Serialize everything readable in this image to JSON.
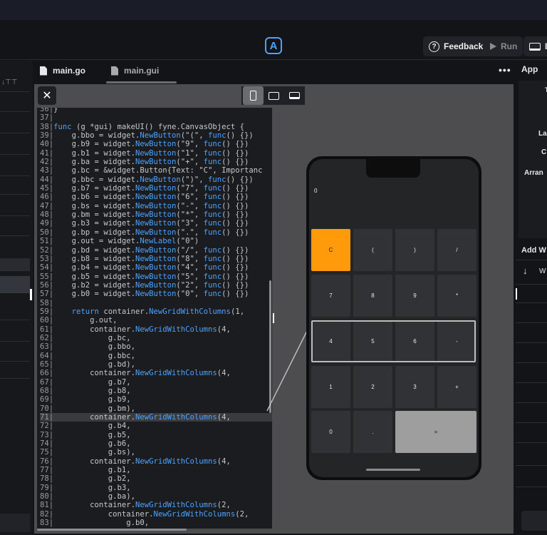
{
  "toolbar": {
    "feedback_label": "Feedback",
    "run_label": "Run",
    "install_label": "In"
  },
  "left_panel": {
    "header_glyphs": "↓⊤⊤"
  },
  "tabs": [
    {
      "label": "main.go"
    },
    {
      "label": "main.gui"
    }
  ],
  "more_label": "•••",
  "code": {
    "lines": [
      {
        "n": "36",
        "t": "}"
      },
      {
        "n": "37",
        "t": ""
      },
      {
        "n": "38",
        "t": "func (g *gui) makeUI() fyne.CanvasObject {"
      },
      {
        "n": "39",
        "t": "    g.bbo = widget.NewButton(\"(\", func() {})"
      },
      {
        "n": "40",
        "t": "    g.b9 = widget.NewButton(\"9\", func() {})"
      },
      {
        "n": "41",
        "t": "    g.b1 = widget.NewButton(\"1\", func() {})"
      },
      {
        "n": "42",
        "t": "    g.ba = widget.NewButton(\"+\", func() {})"
      },
      {
        "n": "43",
        "t": "    g.bc = &widget.Button{Text: \"C\", Importanc"
      },
      {
        "n": "44",
        "t": "    g.bbc = widget.NewButton(\")\", func() {})"
      },
      {
        "n": "45",
        "t": "    g.b7 = widget.NewButton(\"7\", func() {})"
      },
      {
        "n": "46",
        "t": "    g.b6 = widget.NewButton(\"6\", func() {})"
      },
      {
        "n": "47",
        "t": "    g.bs = widget.NewButton(\"-\", func() {})"
      },
      {
        "n": "48",
        "t": "    g.bm = widget.NewButton(\"*\", func() {})"
      },
      {
        "n": "49",
        "t": "    g.b3 = widget.NewButton(\"3\", func() {})"
      },
      {
        "n": "50",
        "t": "    g.bp = widget.NewButton(\".\", func() {})"
      },
      {
        "n": "51",
        "t": "    g.out = widget.NewLabel(\"0\")"
      },
      {
        "n": "52",
        "t": "    g.bd = widget.NewButton(\"/\", func() {})"
      },
      {
        "n": "53",
        "t": "    g.b8 = widget.NewButton(\"8\", func() {})"
      },
      {
        "n": "54",
        "t": "    g.b4 = widget.NewButton(\"4\", func() {})"
      },
      {
        "n": "55",
        "t": "    g.b5 = widget.NewButton(\"5\", func() {})"
      },
      {
        "n": "56",
        "t": "    g.b2 = widget.NewButton(\"2\", func() {})"
      },
      {
        "n": "57",
        "t": "    g.b0 = widget.NewButton(\"0\", func() {})"
      },
      {
        "n": "58",
        "t": ""
      },
      {
        "n": "59",
        "t": "    return container.NewGridWithColumns(1,"
      },
      {
        "n": "60",
        "t": "        g.out,"
      },
      {
        "n": "61",
        "t": "        container.NewGridWithColumns(4,"
      },
      {
        "n": "62",
        "t": "            g.bc,"
      },
      {
        "n": "63",
        "t": "            g.bbo,"
      },
      {
        "n": "64",
        "t": "            g.bbc,"
      },
      {
        "n": "65",
        "t": "            g.bd),"
      },
      {
        "n": "66",
        "t": "        container.NewGridWithColumns(4,"
      },
      {
        "n": "67",
        "t": "            g.b7,"
      },
      {
        "n": "68",
        "t": "            g.b8,"
      },
      {
        "n": "69",
        "t": "            g.b9,"
      },
      {
        "n": "70",
        "t": "            g.bm),"
      },
      {
        "n": "71",
        "t": "        container.NewGridWithColumns(4,"
      },
      {
        "n": "72",
        "t": "            g.b4,"
      },
      {
        "n": "73",
        "t": "            g.b5,"
      },
      {
        "n": "74",
        "t": "            g.b6,"
      },
      {
        "n": "75",
        "t": "            g.bs),"
      },
      {
        "n": "76",
        "t": "        container.NewGridWithColumns(4,"
      },
      {
        "n": "77",
        "t": "            g.b1,"
      },
      {
        "n": "78",
        "t": "            g.b2,"
      },
      {
        "n": "79",
        "t": "            g.b3,"
      },
      {
        "n": "80",
        "t": "            g.ba),"
      },
      {
        "n": "81",
        "t": "        container.NewGridWithColumns(2,"
      },
      {
        "n": "82",
        "t": "            container.NewGridWithColumns(2,"
      },
      {
        "n": "83",
        "t": "                g.b0,"
      }
    ],
    "highlighted_line": "71"
  },
  "preview": {
    "output": "0",
    "buttons": [
      {
        "label": "C",
        "style": "orange"
      },
      {
        "label": "(",
        "style": "normal"
      },
      {
        "label": ")",
        "style": "normal"
      },
      {
        "label": "/",
        "style": "normal"
      },
      {
        "label": "7",
        "style": "normal"
      },
      {
        "label": "8",
        "style": "normal"
      },
      {
        "label": "9",
        "style": "normal"
      },
      {
        "label": "*",
        "style": "normal"
      },
      {
        "label": "4",
        "style": "normal"
      },
      {
        "label": "5",
        "style": "normal"
      },
      {
        "label": "6",
        "style": "normal"
      },
      {
        "label": "-",
        "style": "normal"
      },
      {
        "label": "1",
        "style": "normal"
      },
      {
        "label": "2",
        "style": "normal"
      },
      {
        "label": "3",
        "style": "normal"
      },
      {
        "label": "+",
        "style": "normal"
      },
      {
        "label": "0",
        "style": "normal"
      },
      {
        "label": ".",
        "style": "normal"
      },
      {
        "label": "=",
        "style": "wide"
      }
    ]
  },
  "right_panel": {
    "header": "App",
    "box_labels": [
      "T",
      "La",
      "C",
      "Arran"
    ],
    "add_widget": "Add W",
    "add_item": "W"
  },
  "colors": {
    "accent": "#4aa3ff",
    "orange": "#ff9a0a"
  }
}
